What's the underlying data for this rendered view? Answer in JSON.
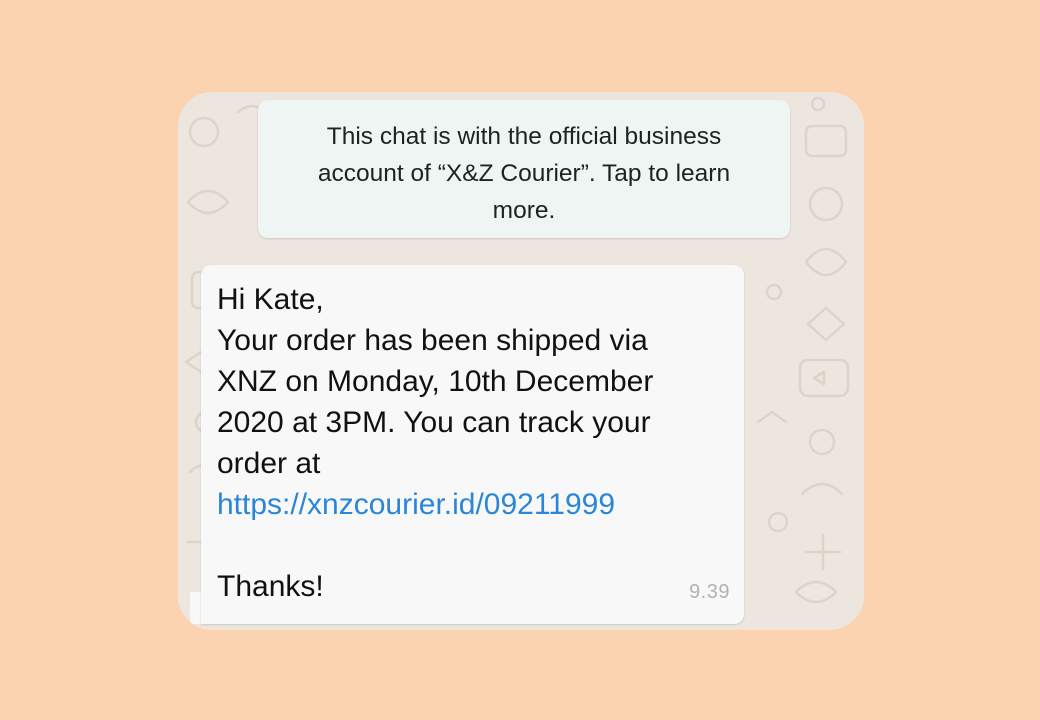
{
  "chat": {
    "notice": "This chat is with the official business account of “X&Z Courier”. Tap to learn more.",
    "message": {
      "greeting": "Hi Kate,",
      "body_lines": [
        "Your order has been shipped via",
        "XNZ on Monday, 10th December",
        "2020 at 3PM. You can track your",
        "order at"
      ],
      "link": "https://xnzcourier.id/09211999",
      "closing": "Thanks!",
      "time": "9.39"
    }
  },
  "colors": {
    "page_background": "#fbd3b1",
    "chat_wallpaper": "#ece6df",
    "notice_background": "#eef5f2",
    "bubble_background": "#f8f8f8",
    "link": "#2a86d8",
    "timestamp": "#b1b1b1"
  },
  "icons": [
    "wallpaper-doodle-pattern"
  ]
}
